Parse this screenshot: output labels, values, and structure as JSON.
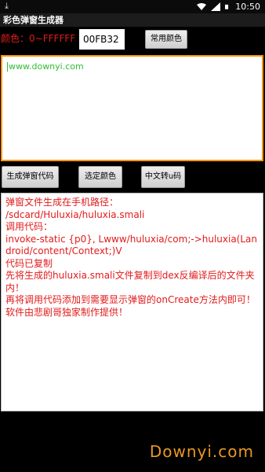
{
  "statusbar": {
    "time": "10:50"
  },
  "title": "彩色弹窗生成器",
  "color_label": "颜色：0~FFFFFF",
  "color_input": "00FB32",
  "buttons": {
    "common_colors": "常用颜色",
    "generate": "生成弹窗代码",
    "pick_color": "选定颜色",
    "chinese_to_u": "中文转u码"
  },
  "code_area": {
    "text": "www.downyi.com"
  },
  "output_lines": [
    "弹窗文件生成在手机路径：",
    "/sdcard/Huluxia/huluxia.smali",
    "调用代码：",
    " invoke-static {p0}, Lwww/huluxia/com;->huluxia(Landroid/content/Context;)V",
    "代码已复制",
    "先将生成的huluxia.smali文件复制到dex反编译后的文件夹内！",
    "再将调用代码添加到需要显示弹窗的onCreate方法内即可！",
    "软件由悲剧哥独家制作提供！"
  ],
  "watermark": "Downyi.com",
  "colors": {
    "accent": "#ff9800",
    "red_text": "#e21b1b",
    "green_text": "#33bb33"
  }
}
